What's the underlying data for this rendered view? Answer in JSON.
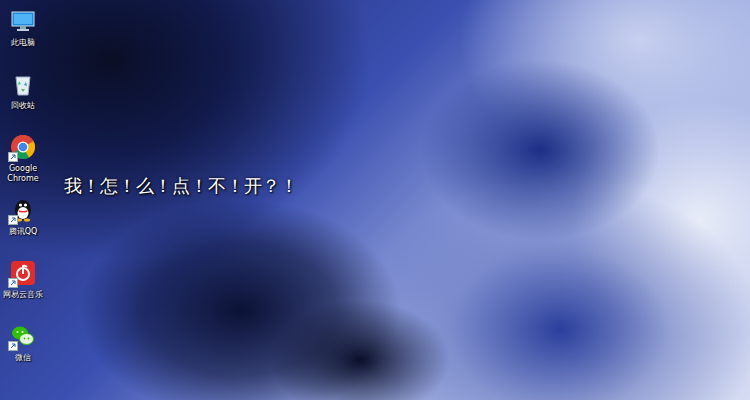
{
  "desktop": {
    "icons": [
      {
        "label": "此电脑",
        "kind": "computer"
      },
      {
        "label": "回收站",
        "kind": "recycle-bin"
      },
      {
        "label": "Google Chrome",
        "kind": "chrome"
      },
      {
        "label": "腾讯QQ",
        "kind": "qq"
      },
      {
        "label": "网易云音乐",
        "kind": "netease-music"
      },
      {
        "label": "微信",
        "kind": "wechat"
      }
    ]
  },
  "caption": "我！怎！么！点！不！开？！"
}
